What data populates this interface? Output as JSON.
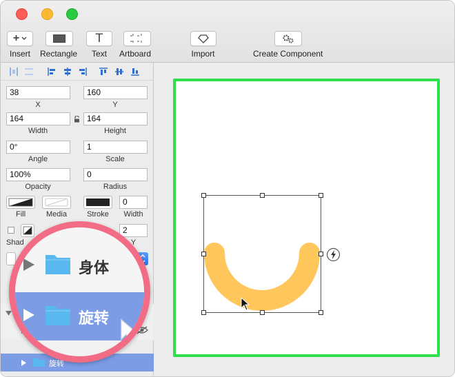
{
  "toolbar": {
    "insert": "Insert",
    "rectangle": "Rectangle",
    "text": "Text",
    "artboard": "Artboard",
    "import": "Import",
    "create_component": "Create Component",
    "text_glyph": "T",
    "insert_glyph": "+"
  },
  "inspector": {
    "x_value": "38",
    "x_label": "X",
    "y_value": "160",
    "y_label": "Y",
    "width_value": "164",
    "width_label": "Width",
    "height_value": "164",
    "height_label": "Height",
    "angle_value": "0°",
    "angle_label": "Angle",
    "scale_value": "1",
    "scale_label": "Scale",
    "opacity_value": "100%",
    "opacity_label": "Opacity",
    "radius_value": "0",
    "radius_label": "Radius",
    "fill_label": "Fill",
    "media_label": "Media",
    "stroke_label": "Stroke",
    "stroke_width_value": "0",
    "stroke_width_label": "Width",
    "shadow_label": "Shad",
    "shadow_y_value": "2",
    "shadow_y_label": "Y",
    "partial_label": "rs"
  },
  "layers": {
    "rotate_layer": "旋转"
  },
  "magnifier": {
    "body_label": "身体",
    "rotate_label": "旋转"
  },
  "colors": {
    "artboard_border": "#2fe04a",
    "arc_fill": "#ffc65c",
    "selection": "#7c9ce6",
    "magnifier_ring": "#f36c86",
    "folder": "#5ab8f0"
  }
}
